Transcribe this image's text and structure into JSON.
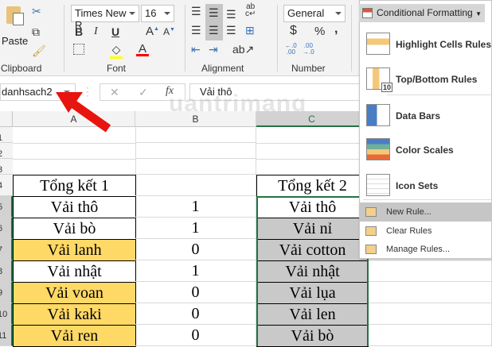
{
  "ribbon": {
    "clipboard": {
      "paste": "Paste",
      "label": "Clipboard"
    },
    "font": {
      "name": "Times New R",
      "size": "16",
      "bold": "B",
      "italic": "I",
      "underline": "U",
      "label": "Font",
      "fill_color": "#ffff00",
      "font_color": "#ff0000"
    },
    "alignment": {
      "label": "Alignment"
    },
    "number": {
      "format": "General",
      "currency": "$",
      "percent": "%",
      "comma": ",",
      "label": "Number"
    },
    "conditional_formatting": {
      "label": "Conditional Formatting"
    }
  },
  "formula_bar": {
    "name_box": "danhsach2",
    "cancel": "✕",
    "enter": "✓",
    "fx": "fx",
    "value": "Vải thô"
  },
  "watermark": "uantrimang",
  "columns": [
    "A",
    "B",
    "C"
  ],
  "rows": [
    "1",
    "2",
    "3",
    "4",
    "5",
    "6",
    "7",
    "8",
    "9",
    "10",
    "11"
  ],
  "table1": {
    "header": "Tổng kết 1",
    "items": [
      "Vải thô",
      "Vải bò",
      "Vải lanh",
      "Vải nhật",
      "Vải voan",
      "Vải kaki",
      "Vải ren"
    ],
    "highlighted": [
      false,
      false,
      true,
      false,
      true,
      true,
      true
    ]
  },
  "column_b": [
    "1",
    "1",
    "0",
    "1",
    "0",
    "0",
    "0"
  ],
  "table2": {
    "header": "Tổng kết 2",
    "items": [
      "Vải thô",
      "Vải nỉ",
      "Vải cotton",
      "Vải nhật",
      "Vải lụa",
      "Vải len",
      "Vải bò"
    ]
  },
  "colors": {
    "highlight_yellow": "#ffd966",
    "highlight_gray": "#c9c9c9",
    "selection_green": "#217346",
    "arrow_red": "#e8140f"
  },
  "menu": {
    "items": [
      {
        "label": "Highlight Cells Rules",
        "icon": "highlight-cells-icon"
      },
      {
        "label": "Top/Bottom Rules",
        "icon": "top-bottom-icon"
      },
      {
        "label": "Data Bars",
        "icon": "data-bars-icon"
      },
      {
        "label": "Color Scales",
        "icon": "color-scales-icon"
      },
      {
        "label": "Icon Sets",
        "icon": "icon-sets-icon"
      }
    ],
    "sub_items": [
      {
        "label": "New Rule...",
        "highlighted": true
      },
      {
        "label": "Clear Rules"
      },
      {
        "label": "Manage Rules..."
      }
    ],
    "top_bottom_badge": "10"
  }
}
